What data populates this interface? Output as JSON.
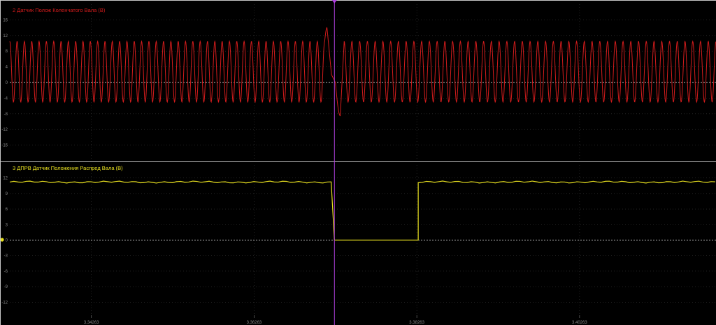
{
  "colors": {
    "background": "#000000",
    "frame": "#c8c8c8",
    "grid": "#3a3a3a",
    "zero_line": "#ffffff",
    "cursor": "#b040e0",
    "ch2": "#d41c1c",
    "ch3": "#e8e020"
  },
  "chart_data": [
    {
      "type": "line",
      "title": "2 Датчик Полож Коленчатого Вала (В)",
      "yticks": [
        16,
        12,
        8,
        4,
        0,
        -4,
        -8,
        -12,
        -16
      ],
      "ytick_labels": [
        "16",
        "12",
        "8",
        "4",
        "0",
        "-4",
        "-8",
        "-12",
        "-16"
      ],
      "ylim": [
        -20,
        20
      ],
      "series": [
        {
          "description": "sinusoidal crank sensor signal with missing-tooth gap",
          "amplitude_high": 10.5,
          "amplitude_low": -5.0,
          "cycles_before_gap": 43,
          "cycles_after_gap": 48,
          "gap_peak": 14,
          "gap_trough": -8.5,
          "x_start": 3.3326,
          "x_gap_start": 3.3713,
          "x_gap_end": 3.3737,
          "x_end": 3.4194
        }
      ]
    },
    {
      "type": "line",
      "title": "3 ДПРВ Датчик Положения Распред Вала (В)",
      "yticks": [
        12,
        9,
        6,
        3,
        0,
        -3,
        -6,
        -9,
        -12
      ],
      "ytick_labels": [
        "12",
        "9",
        "6",
        "3",
        "0",
        "-3",
        "-6",
        "-9",
        "-12"
      ],
      "ylim": [
        -14.5,
        14.5
      ],
      "series": [
        {
          "description": "cam sensor square signal",
          "high": 11.2,
          "low": 0,
          "x_start": 3.3326,
          "x_fall": 3.3725,
          "x_rise": 3.3828,
          "x_end": 3.4194
        }
      ]
    }
  ],
  "x_axis": {
    "xlim": [
      3.3326,
      3.4194
    ],
    "ticks": [
      3.34263,
      3.36263,
      3.38263,
      3.40263
    ],
    "tick_labels": [
      "3.34263",
      "3.36263",
      "3.38263",
      "3.40263"
    ],
    "cursor_x": 3.3725
  }
}
